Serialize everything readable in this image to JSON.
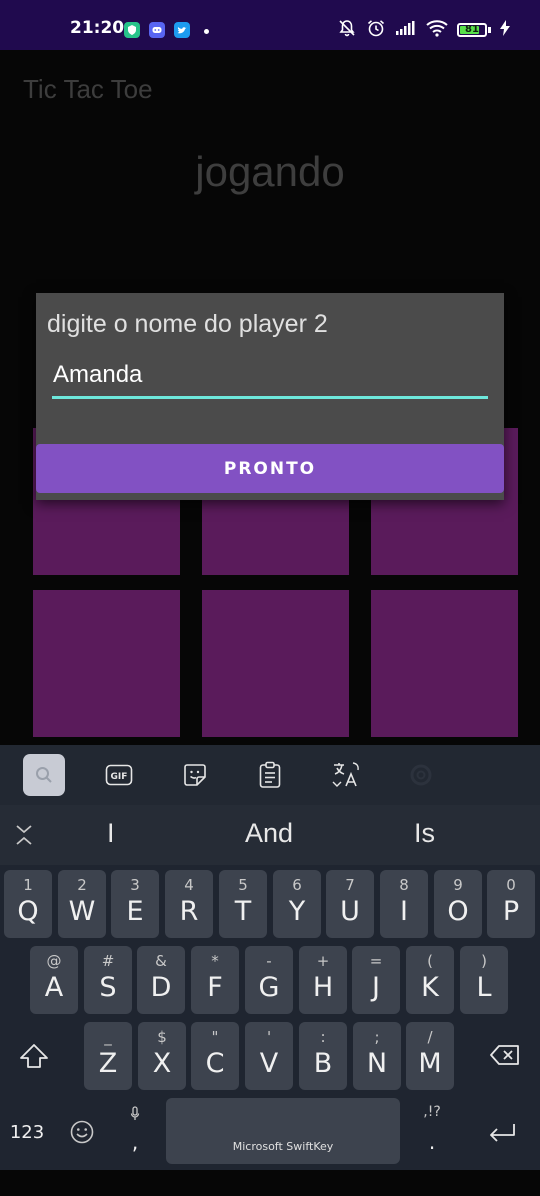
{
  "status_bar": {
    "time": "21:20",
    "battery": "81",
    "battery_level": 0.81,
    "left_icons": [
      "vpn-shield-icon",
      "discord-icon",
      "twitter-icon"
    ],
    "right_icons": [
      "mute-icon",
      "alarm-icon",
      "signal-icon",
      "wifi-icon",
      "battery-icon",
      "charging-icon"
    ],
    "colors": {
      "bar": "#200a4e",
      "battery_fill": "#58e04a"
    }
  },
  "app": {
    "title": "Tic Tac Toe",
    "status": "jogando",
    "cell_color": "#5a1b5b"
  },
  "dialog": {
    "message": "digite o nome do player 2",
    "input_value": "Amanda",
    "button_label": "PRONTO",
    "colors": {
      "button": "#8251c3",
      "underline": "#6ee8dc"
    }
  },
  "keyboard": {
    "toolbar": [
      "search-icon",
      "gif-icon",
      "sticker-icon",
      "clipboard-icon",
      "translate-icon",
      "settings-icon"
    ],
    "suggestions": [
      "I",
      "And",
      "Is"
    ],
    "rows": [
      [
        {
          "m": "Q",
          "h": "1"
        },
        {
          "m": "W",
          "h": "2"
        },
        {
          "m": "E",
          "h": "3"
        },
        {
          "m": "R",
          "h": "4"
        },
        {
          "m": "T",
          "h": "5"
        },
        {
          "m": "Y",
          "h": "6"
        },
        {
          "m": "U",
          "h": "7"
        },
        {
          "m": "I",
          "h": "8"
        },
        {
          "m": "O",
          "h": "9"
        },
        {
          "m": "P",
          "h": "0"
        }
      ],
      [
        {
          "m": "A",
          "h": "@"
        },
        {
          "m": "S",
          "h": "#"
        },
        {
          "m": "D",
          "h": "&"
        },
        {
          "m": "F",
          "h": "*"
        },
        {
          "m": "G",
          "h": "-"
        },
        {
          "m": "H",
          "h": "+"
        },
        {
          "m": "J",
          "h": "="
        },
        {
          "m": "K",
          "h": "("
        },
        {
          "m": "L",
          "h": ")"
        }
      ],
      [
        {
          "m": "Z",
          "h": "_"
        },
        {
          "m": "X",
          "h": "$"
        },
        {
          "m": "C",
          "h": "\""
        },
        {
          "m": "V",
          "h": "'"
        },
        {
          "m": "B",
          "h": ":"
        },
        {
          "m": "N",
          "h": ";"
        },
        {
          "m": "M",
          "h": "/"
        }
      ]
    ],
    "numbers_label": "123",
    "comma": ",",
    "period": ".",
    "period_hint": ",!?",
    "space_label": "Microsoft SwiftKey"
  }
}
